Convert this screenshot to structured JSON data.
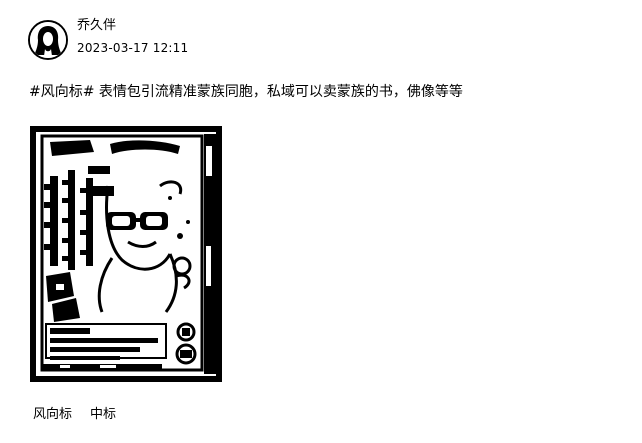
{
  "post": {
    "author": {
      "name": "乔久伴",
      "avatar_icon": "silhouette-avatar-icon"
    },
    "timestamp": "2023-03-17 12:11",
    "hashtag": "#风向标#",
    "body_text": " 表情包引流精准蒙族同胞，私域可以卖蒙族的书，佛像等等",
    "image": {
      "description_icon": "meme-poster-image",
      "caption_lines": [
        "ᠮᠣᠩᠭᠣᠯ ᠪᠢᠴᠢᠭ",
        "ᠲᠡᠮᠳᠡᠭ"
      ]
    },
    "tags": [
      "风向标",
      "中标"
    ]
  }
}
